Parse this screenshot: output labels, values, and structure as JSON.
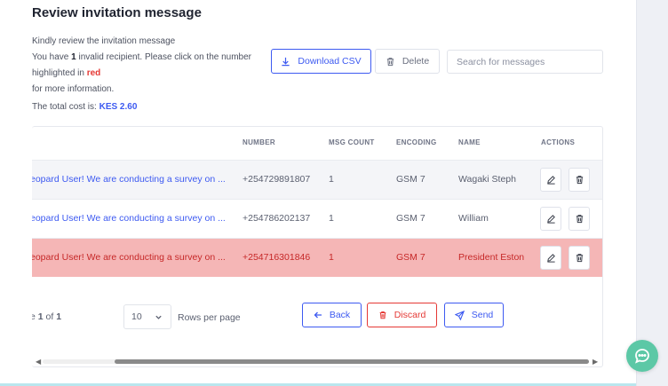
{
  "page": {
    "title": "Review invitation message",
    "intro": "Kindly review the invitation message",
    "invalid_prefix": "You have ",
    "invalid_count": "1",
    "invalid_suffix": " invalid recipient. Please click on the number",
    "highlight_prefix": "highlighted in ",
    "highlight_word": "red",
    "more_info": "for more information.",
    "cost_prefix": "The total cost is: ",
    "cost_value": "KES 2.60"
  },
  "toolbar": {
    "download_label": "Download CSV",
    "delete_label": "Delete",
    "search_placeholder": "Search for messages"
  },
  "table": {
    "columns": [
      "NUMBER",
      "MSG COUNT",
      "ENCODING",
      "NAME",
      "ACTIONS"
    ],
    "rows": [
      {
        "message": "eopard User! We are conducting a survey on ...",
        "number": "+254729891807",
        "msg_count": "1",
        "encoding": "GSM 7",
        "name": "Wagaki Steph",
        "invalid": false
      },
      {
        "message": "eopard User! We are conducting a survey on ...",
        "number": "+254786202137",
        "msg_count": "1",
        "encoding": "GSM 7",
        "name": "William",
        "invalid": false
      },
      {
        "message": "eopard User! We are conducting a survey on ...",
        "number": "+254716301846",
        "msg_count": "1",
        "encoding": "GSM 7",
        "name": "President Eston",
        "invalid": true
      }
    ]
  },
  "pagination": {
    "page_prefix": "e ",
    "current_page": "1",
    "of_label": " of ",
    "total_pages": "1",
    "rows_per_page_value": "10",
    "rows_per_page_label": "Rows per page"
  },
  "actions": {
    "back_label": "Back",
    "discard_label": "Discard",
    "send_label": "Send"
  },
  "colors": {
    "accent": "#3d5af1",
    "danger": "#e53935",
    "invalid_row_bg": "#f5b6b6",
    "chat_fab": "#5cc8a6"
  },
  "icons": [
    "download-icon",
    "trash-icon",
    "edit-icon",
    "arrow-left-icon",
    "send-icon",
    "chevron-down-icon",
    "chat-icon"
  ]
}
